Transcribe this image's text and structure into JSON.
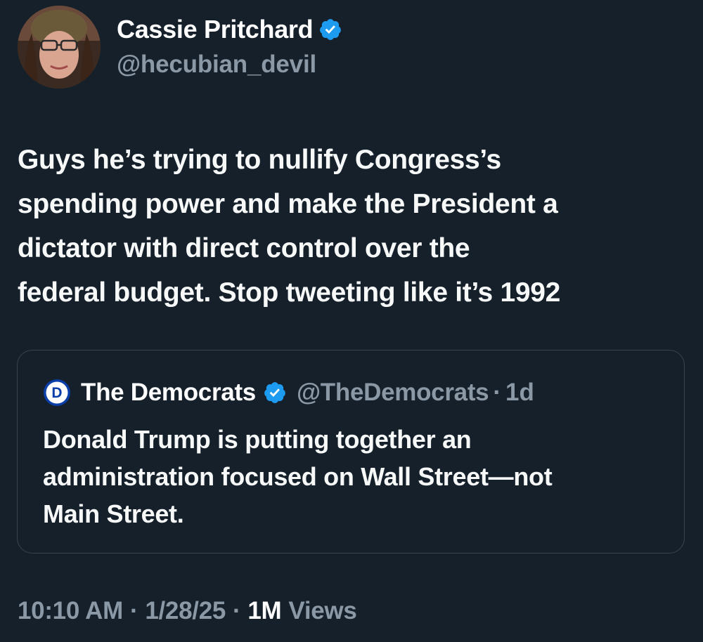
{
  "tweet": {
    "author": {
      "display_name": "Cassie Pritchard",
      "handle": "@hecubian_devil",
      "avatar_icon": "profile-photo",
      "verified_icon": "verified-badge-icon"
    },
    "text_lines": [
      "Guys he’s trying to nullify Congress’s",
      "spending power and make the President a",
      "dictator with direct control over the",
      "federal budget. Stop tweeting like it’s 1992"
    ],
    "quoted": {
      "logo_icon": "democrats-logo-icon",
      "logo_letter": "D",
      "display_name": "The Democrats",
      "handle": "@TheDemocrats",
      "separator": "·",
      "time": "1d",
      "text_lines": [
        "Donald Trump is putting together an",
        "administration focused on Wall Street—not",
        "Main Street."
      ]
    },
    "meta": {
      "time": "10:10 AM",
      "separator": "·",
      "date": "1/28/25",
      "views_count": "1M",
      "views_label": "Views"
    }
  },
  "colors": {
    "background": "#15202b",
    "text_primary": "#ffffff",
    "text_secondary": "#8b98a5",
    "verified_blue": "#1d9bf0",
    "border": "#38444d",
    "democrats_blue": "#0a3ea8"
  }
}
